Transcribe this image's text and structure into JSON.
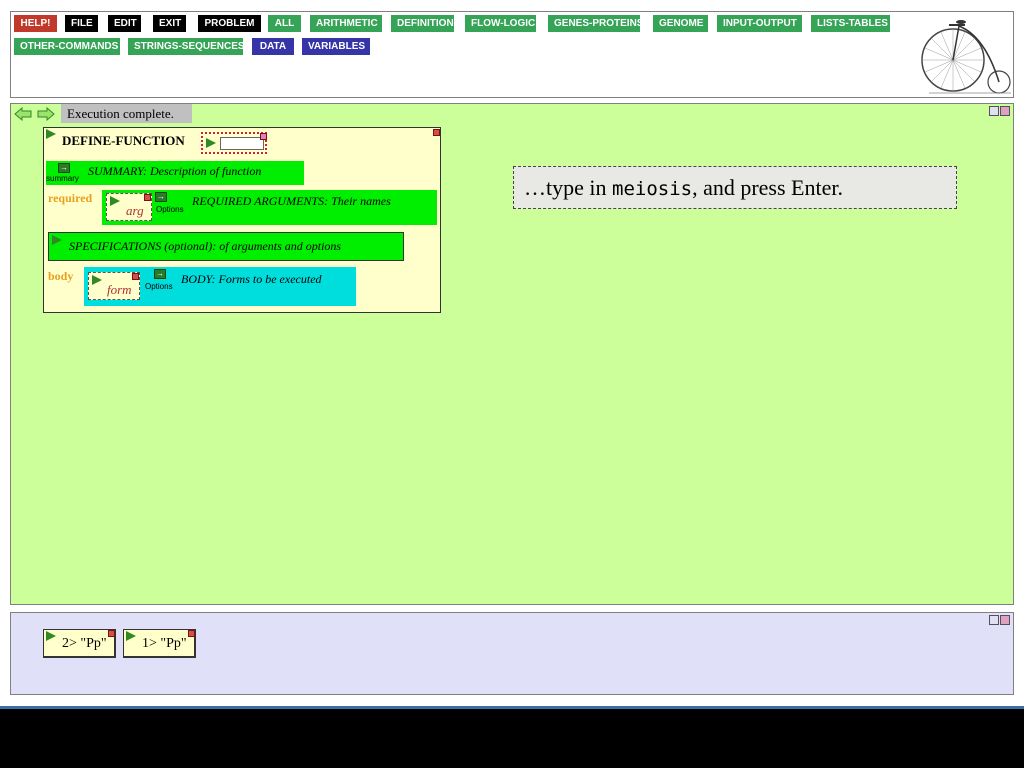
{
  "toolbar": {
    "row1": [
      {
        "label": "HELP!",
        "color": "red"
      },
      {
        "label": "FILE",
        "color": "black"
      },
      {
        "label": "EDIT",
        "color": "black"
      },
      {
        "label": "EXIT",
        "color": "black"
      },
      {
        "label": "PROBLEM",
        "color": "black"
      },
      {
        "label": "ALL",
        "color": "green"
      },
      {
        "label": "ARITHMETIC",
        "color": "green"
      },
      {
        "label": "DEFINITION",
        "color": "green"
      },
      {
        "label": "FLOW-LOGIC",
        "color": "green"
      },
      {
        "label": "GENES-PROTEINS",
        "color": "green"
      },
      {
        "label": "GENOME",
        "color": "green"
      },
      {
        "label": "INPUT-OUTPUT",
        "color": "green"
      },
      {
        "label": "LISTS-TABLES",
        "color": "green"
      }
    ],
    "row2": [
      {
        "label": "OTHER-COMMANDS",
        "color": "green"
      },
      {
        "label": "STRINGS-SEQUENCES",
        "color": "green"
      },
      {
        "label": "DATA",
        "color": "blue"
      },
      {
        "label": "VARIABLES",
        "color": "blue"
      }
    ],
    "logo_icon": "penny-farthing-bicycle-icon"
  },
  "workspace": {
    "status": "Execution complete.",
    "back_icon": "back-arrow-icon",
    "forward_icon": "forward-arrow-icon",
    "define_function": {
      "title": "DEFINE-FUNCTION",
      "summary_label": "summary",
      "summary_text": "SUMMARY: Description of function",
      "required_label": "required",
      "arg_placeholder": "arg",
      "options_label": "Options",
      "required_text": "REQUIRED ARGUMENTS: Their names",
      "specifications_text": "SPECIFICATIONS (optional): of arguments and options",
      "body_label": "body",
      "form_placeholder": "form",
      "body_text": "BODY: Forms to be executed"
    },
    "hint": {
      "prefix": "…type in ",
      "code": "meiosis",
      "suffix": ", and press Enter."
    }
  },
  "history": {
    "items": [
      {
        "label": "2> \"Pp\""
      },
      {
        "label": "1> \"Pp\""
      }
    ]
  },
  "colors": {
    "workspace_bg": "#ccff99",
    "history_bg": "#e0e0f8",
    "function_box_bg": "#ffffcc",
    "green_block": "#00ee00",
    "cyan_block": "#00dddd",
    "label_orange": "#e8a020"
  }
}
